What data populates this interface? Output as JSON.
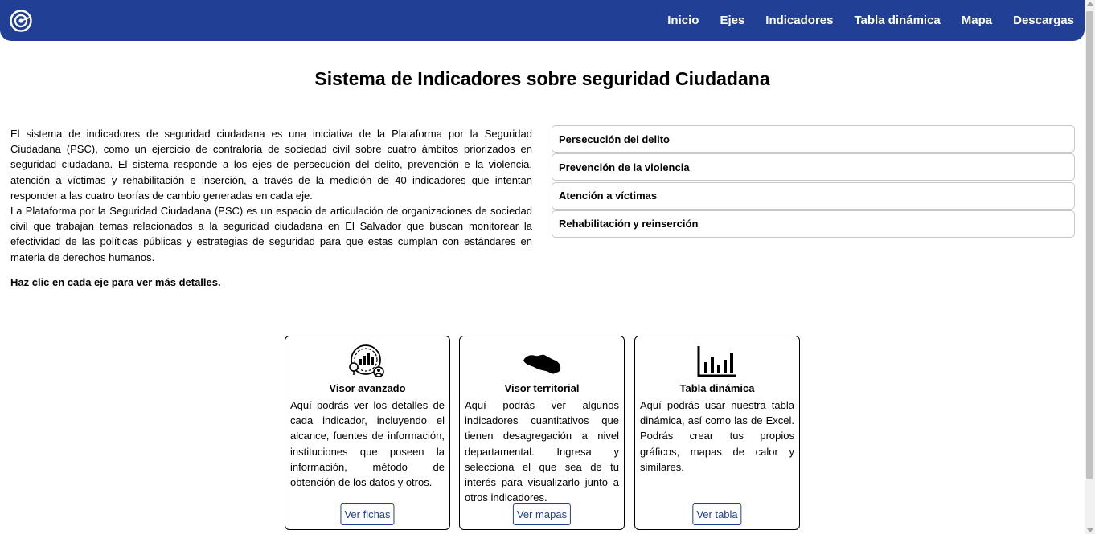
{
  "nav": {
    "links": [
      "Inicio",
      "Ejes",
      "Indicadores",
      "Tabla dinámica",
      "Mapa",
      "Descargas"
    ],
    "brand_color": "#213f95"
  },
  "header": {
    "title": "Sistema de Indicadores sobre seguridad Ciudadana"
  },
  "intro": {
    "paragraph1": "El sistema de indicadores de seguridad ciudadana es una iniciativa de la Plataforma por la Seguridad Ciudadana (PSC), como un ejercicio de contraloría de sociedad civil sobre cuatro ámbitos priorizados en seguridad ciudadana. El sistema responde a los ejes de persecución del delito, prevención e la violencia, atención a víctimas y rehabilitación e inserción, a través de la medición de 40 indicadores que intentan responder a las cuatro teorías de cambio generadas en cada eje.",
    "paragraph2": "La Plataforma por la Seguridad Ciudadana (PSC) es un espacio de articulación de organizaciones de sociedad civil que trabajan temas relacionados a la seguridad ciudadana en El Salvador que buscan monitorear la efectividad de las políticas públicas y estrategias de seguridad para que estas cumplan con estándares en materia de derechos humanos.",
    "hint": "Haz clic en cada eje para ver más detalles."
  },
  "axes": [
    "Persecución del delito",
    "Prevención de la violencia",
    "Atención a víctimas",
    "Rehabilitación y reinserción"
  ],
  "cards": [
    {
      "icon": "analytics-gear-icon",
      "title": "Visor avanzado",
      "description": "Aquí podrás ver los detalles de cada indicador, incluyendo el alcance, fuentes de información, instituciones que poseen la información, método de obtención de los datos y otros.",
      "button": "Ver fichas"
    },
    {
      "icon": "el-salvador-map-icon",
      "title": "Visor territorial",
      "description": "Aquí podrás ver algunos indicadores cuantitativos que tienen desagregación a nivel departamental. Ingresa y selecciona el que sea de tu interés para visualizarlo junto a otros indicadores.",
      "button": "Ver mapas"
    },
    {
      "icon": "bar-chart-icon",
      "title": "Tabla dinámica",
      "description": "Aquí podrás usar nuestra tabla dinámica, así como las de Excel. Podrás crear tus propios gráficos, mapas de calor y similares.",
      "button": "Ver tabla"
    }
  ]
}
